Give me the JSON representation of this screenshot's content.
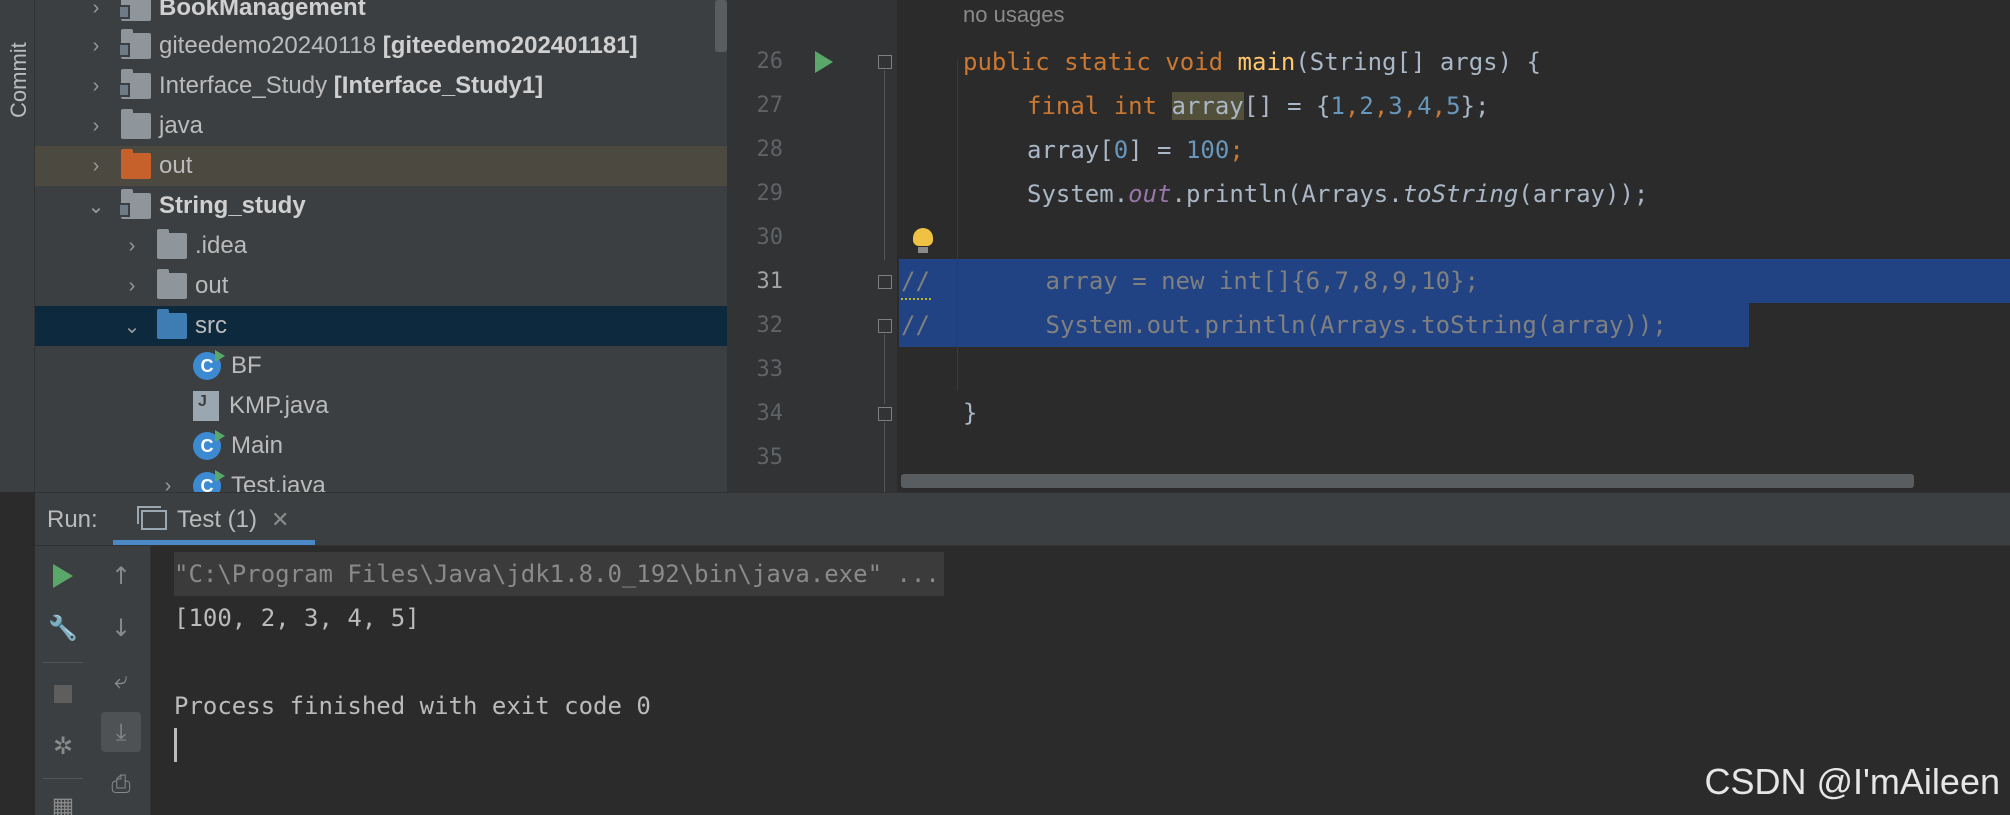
{
  "left_strip": {
    "label": "Commit"
  },
  "project_tree": {
    "items": [
      {
        "name": "BookManagement",
        "suffix": ""
      },
      {
        "name": "giteedemo20240118",
        "suffix": "[giteedemo202401181]"
      },
      {
        "name": "Interface_Study",
        "suffix": "[Interface_Study1]"
      },
      {
        "name": "java",
        "suffix": ""
      },
      {
        "name": "out",
        "suffix": ""
      },
      {
        "name": "String_study",
        "suffix": ""
      },
      {
        "name": ".idea",
        "suffix": ""
      },
      {
        "name": "out",
        "suffix": ""
      },
      {
        "name": "src",
        "suffix": ""
      },
      {
        "name": "BF",
        "suffix": ""
      },
      {
        "name": "KMP.java",
        "suffix": ""
      },
      {
        "name": "Main",
        "suffix": ""
      },
      {
        "name": "Test.java",
        "suffix": ""
      }
    ]
  },
  "editor": {
    "hint": "no usages",
    "line_numbers": [
      "26",
      "27",
      "28",
      "29",
      "30",
      "31",
      "32",
      "33",
      "34",
      "35"
    ],
    "lines": {
      "l26_kw": "public static void ",
      "l26_fn": "main",
      "l26_rest": "(String[] args) {",
      "l27_kw": "final int ",
      "l27_var": "array",
      "l27_mid": "[] = {",
      "l27_n1": "1",
      "l27_n2": "2",
      "l27_n3": "3",
      "l27_n4": "4",
      "l27_n5": "5",
      "l27_end": "};",
      "l28_pre": "array[",
      "l28_idx": "0",
      "l28_mid": "] = ",
      "l28_val": "100",
      "l28_end": ";",
      "l29_a": "System.",
      "l29_out": "out",
      "l29_b": ".println(Arrays.",
      "l29_ts": "toString",
      "l29_c": "(array));",
      "l31_comment": "//",
      "l31_code": "        array = new int[]{6,7,8,9,10};",
      "l32_comment": "//",
      "l32_code": "        System.out.println(Arrays.toString(array));",
      "l34": "}"
    }
  },
  "run_window": {
    "label": "Run:",
    "tab_label": "Test (1)",
    "console": [
      "\"C:\\Program Files\\Java\\jdk1.8.0_192\\bin\\java.exe\" ...",
      "[100, 2, 3, 4, 5]",
      "",
      "Process finished with exit code 0"
    ]
  },
  "watermark": "CSDN @I'mAileen",
  "colors": {
    "keyword": "#cc7832",
    "function": "#ffc66d",
    "number": "#6897bb",
    "selection": "#214283",
    "run_green": "#59a869"
  }
}
